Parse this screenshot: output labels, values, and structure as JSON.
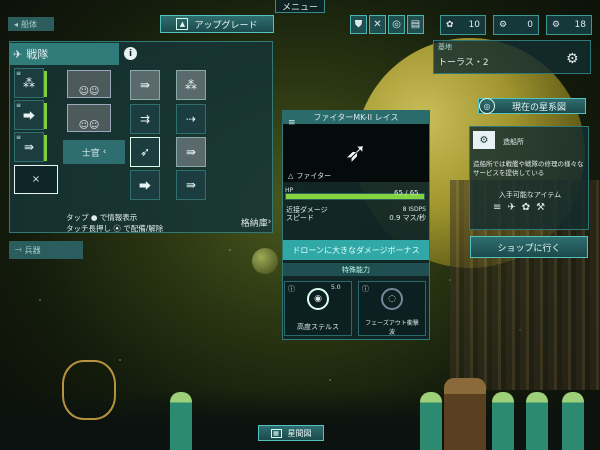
{
  "topbar": {
    "menu": "メニュー",
    "upgrade": "アップグレード",
    "resources": [
      {
        "icon": "crew-icon",
        "value": "10"
      },
      {
        "icon": "gear-icon",
        "value": "0"
      },
      {
        "icon": "credits-icon",
        "value": "18"
      }
    ],
    "nav_icons": [
      "fleet-icon",
      "tools-icon",
      "radar-icon",
      "cards-icon"
    ]
  },
  "left": {
    "ships_tab": "船体",
    "fleet_title": "戦隊",
    "officer": "士官",
    "empty_slot": "×",
    "help_line1": "タップ ● で情報表示",
    "help_line2": "タッチ長押し ⦿ で配備/解除",
    "hangar": "格納庫",
    "weapons_tab": "兵器"
  },
  "card": {
    "title": "ファイターMK-II レイス",
    "type": "ファイター",
    "hp_label": "HP",
    "hp_value": "65 / 65",
    "hp_fraction": 1.0,
    "dmg_label": "近接ダメージ",
    "dmg_value": "8 ISDPS",
    "speed_label": "スピード",
    "speed_value": "0.9 マス/秒",
    "bonus": "ドローンに大きなダメージボーナス",
    "abilities_header": "特殊能力",
    "abilities": [
      {
        "name": "高度ステルス",
        "level": "5.0"
      },
      {
        "name": "フェーズアウト衝撃波",
        "level": ""
      }
    ]
  },
  "right": {
    "base_label": "基地",
    "base_name": "トーラス・2",
    "current_starmap": "現在の星系図",
    "shipyard_title": "造船所",
    "shipyard_desc": "造船所では戦艦や戦隊の修理の様々なサービスを提供している",
    "items_label": "入手可能なアイテム",
    "shop": "ショップに行く"
  },
  "bottom": {
    "starmap": "星間図"
  },
  "colors": {
    "accent": "#2fa8a6",
    "hp": "#85d43f",
    "panel": "#142c2e"
  }
}
